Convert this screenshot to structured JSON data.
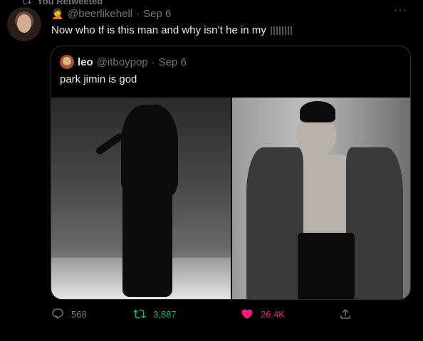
{
  "retweet": {
    "label": "You Retweeted"
  },
  "tweet": {
    "handle": "@beerlikehell",
    "separator": "·",
    "date": "Sep 6",
    "text": "Now who tf is this man and why isn’t he in my",
    "censored_word_icon": "censored-text",
    "more_label": "···"
  },
  "quote": {
    "name": "leo",
    "handle": "@itboypop",
    "separator": "·",
    "date": "Sep 6",
    "text": "park jimin is god"
  },
  "actions": {
    "replies": "568",
    "retweets": "3,887",
    "likes": "26.4K"
  },
  "colors": {
    "background": "#000000",
    "text": "#e7e9ea",
    "muted": "#71767b",
    "border": "#2f3336",
    "retweet_green": "#00ba7c",
    "like_pink": "#f91880"
  }
}
